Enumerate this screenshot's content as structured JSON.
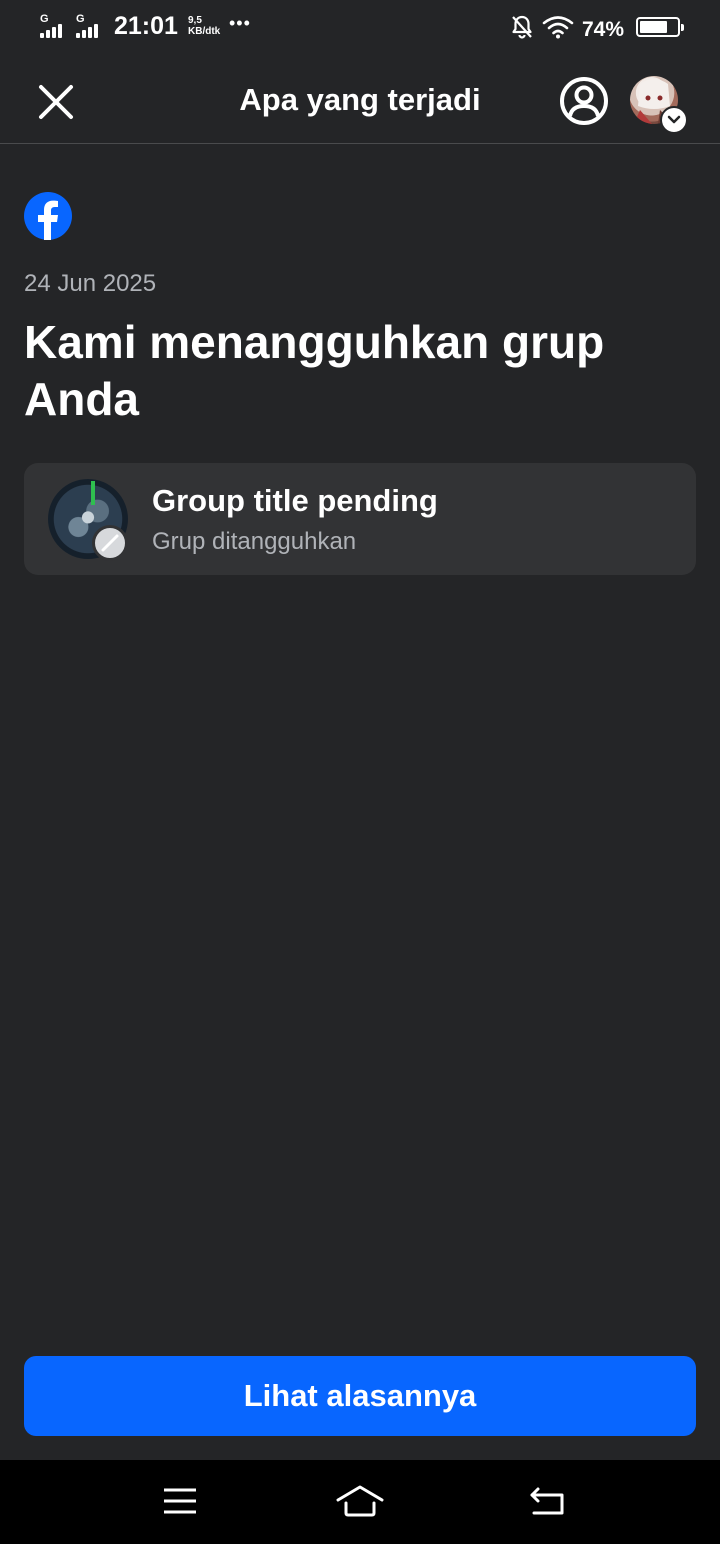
{
  "status_bar": {
    "sim1_type": "G",
    "sim2_type": "G",
    "time": "21:01",
    "net_speed_value": "9,5",
    "net_speed_unit": "KB/dtk",
    "more_dots": "•••",
    "battery_percent": "74%",
    "battery_level": 0.74
  },
  "header": {
    "title": "Apa yang terjadi"
  },
  "notice": {
    "date": "24 Jun 2025",
    "headline": "Kami menangguhkan grup Anda"
  },
  "group_card": {
    "title": "Group title pending",
    "status": "Grup ditangguhkan"
  },
  "actions": {
    "primary_label": "Lihat alasannya"
  },
  "colors": {
    "background": "#242527",
    "card": "#323335",
    "accent": "#0866ff",
    "facebook_blue": "#0866ff",
    "secondary_text": "#b0b3b8"
  },
  "icons": {
    "close": "close-icon",
    "profile": "user-circle-icon",
    "account_switch": "chevron-down-icon",
    "brand": "facebook-logo",
    "restricted": "ban-icon",
    "nav_menu": "menu-icon",
    "nav_home": "home-icon",
    "nav_back": "back-icon"
  }
}
